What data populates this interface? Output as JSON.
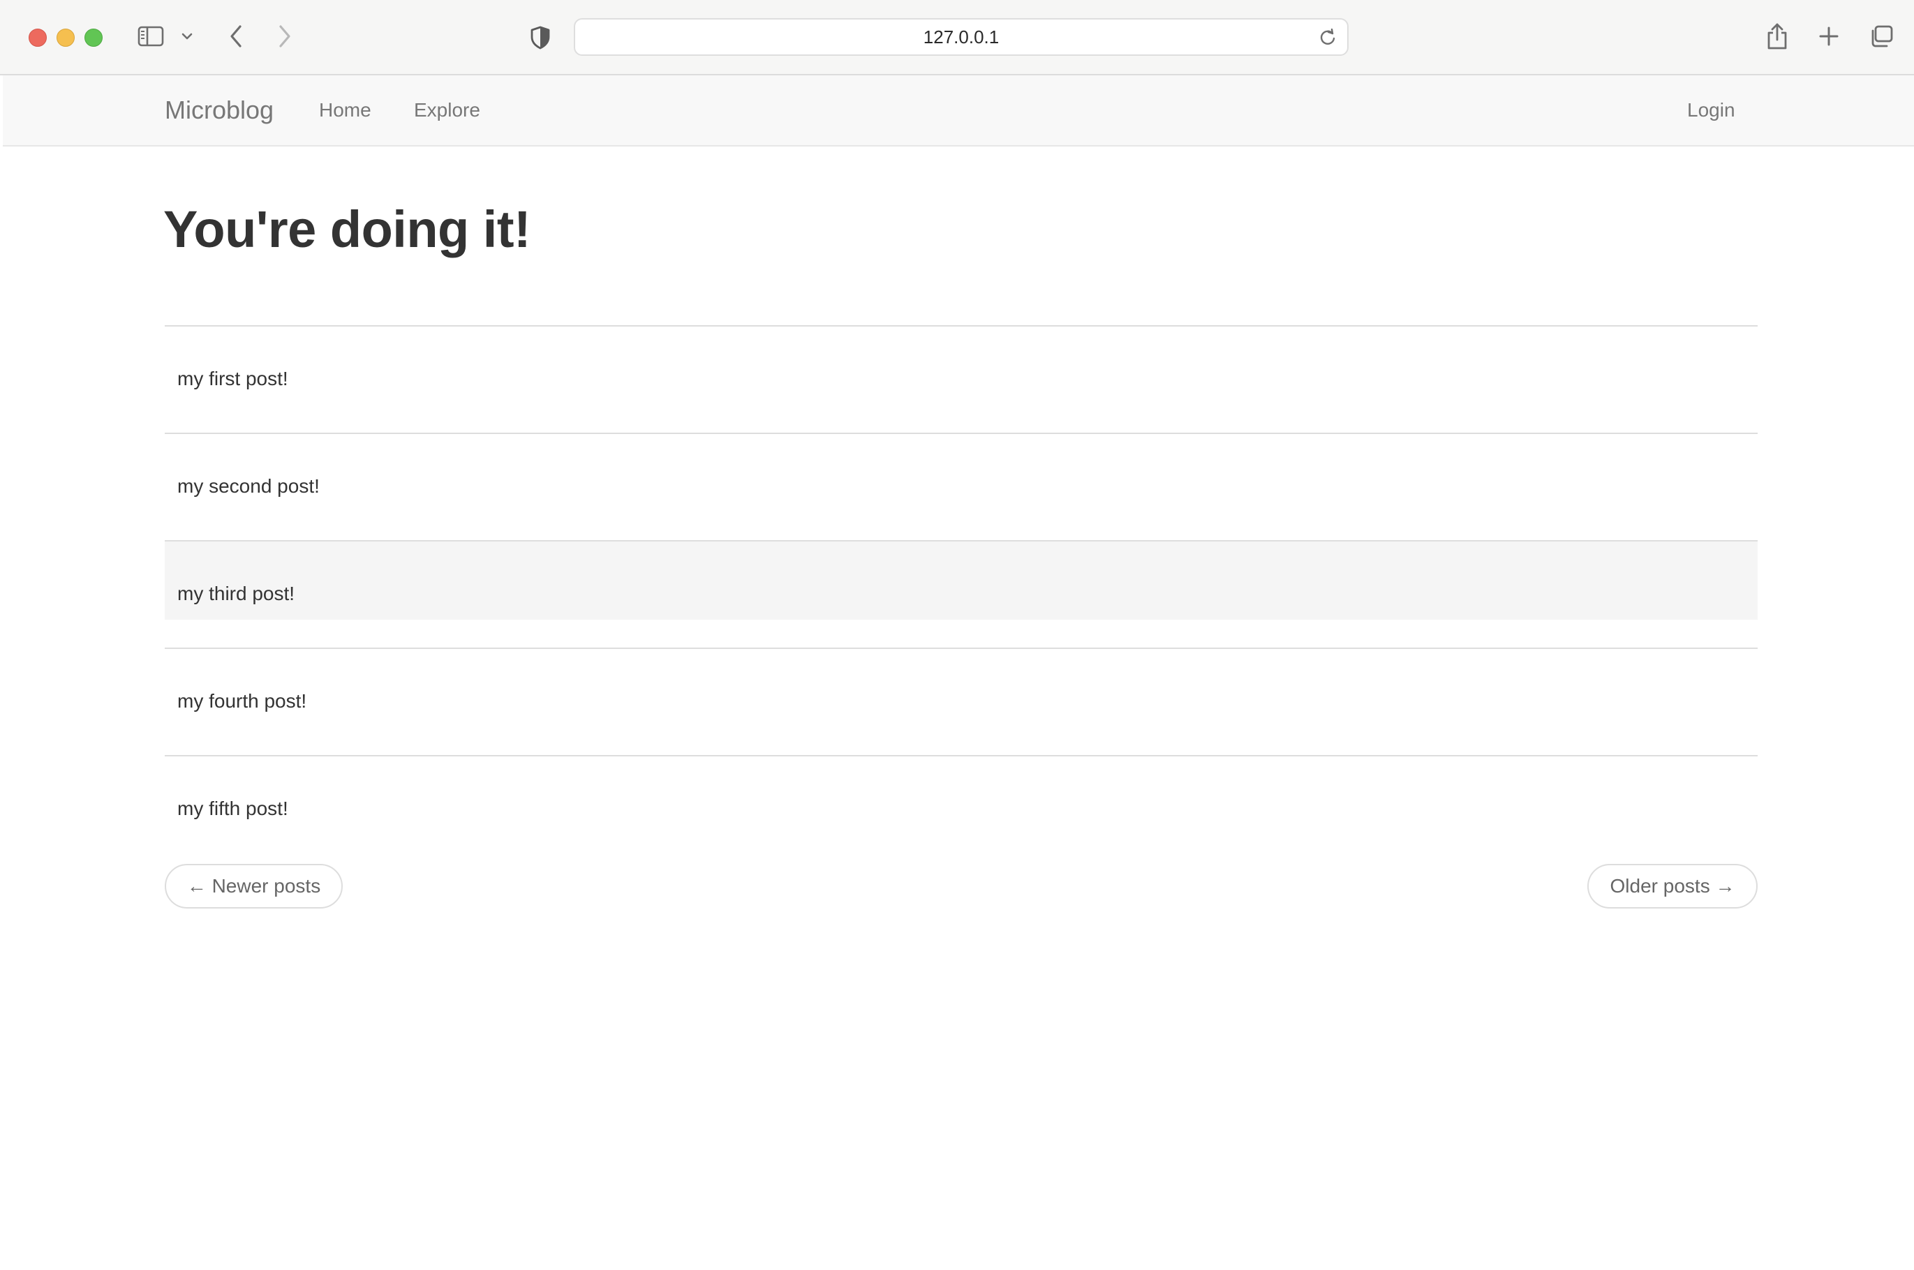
{
  "browser": {
    "url": "127.0.0.1",
    "icons": {
      "sidebar": "sidebar-icon",
      "sidebar_menu": "chevron-down-icon",
      "back": "chevron-left-icon",
      "forward": "chevron-right-icon",
      "privacy": "shield-icon",
      "reload": "reload-icon",
      "share": "share-icon",
      "new_tab": "plus-icon",
      "tabs_overview": "tabs-icon"
    }
  },
  "navbar": {
    "brand": "Microblog",
    "links": [
      {
        "label": "Home"
      },
      {
        "label": "Explore"
      }
    ],
    "login": "Login"
  },
  "main": {
    "title": "You're doing it!",
    "posts": [
      {
        "body": "my first post!"
      },
      {
        "body": "my second post!"
      },
      {
        "body": "my third post!"
      },
      {
        "body": "my fourth post!"
      },
      {
        "body": "my fifth post!"
      }
    ],
    "pager": {
      "newer": "← Newer posts",
      "older": "Older posts →"
    }
  },
  "colors": {
    "navbar_bg": "#f8f8f8",
    "nav_text": "#777777",
    "heading_text": "#333333",
    "row_hover": "#f5f5f5",
    "divider": "#dddddd"
  }
}
